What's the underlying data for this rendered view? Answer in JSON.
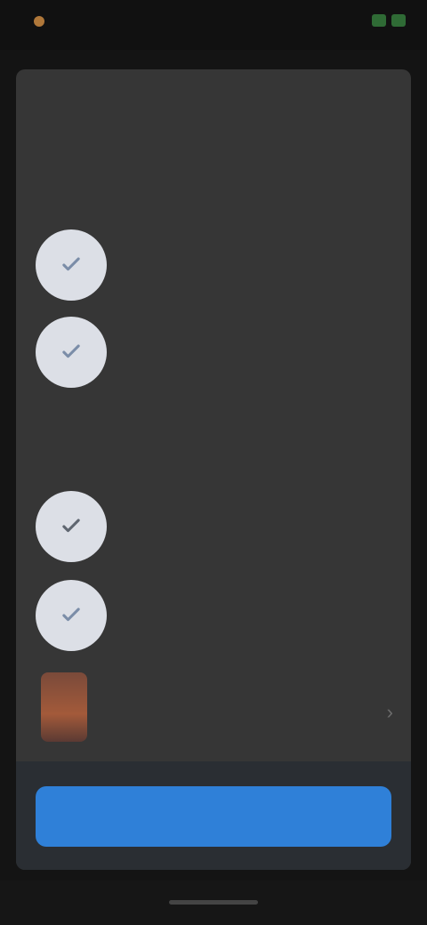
{
  "status_bar": {
    "left_text": "",
    "right_text": ""
  },
  "sheet": {
    "title": "",
    "section_one_label": "",
    "section_two_label": ""
  },
  "rows": [
    {
      "icon": "check-icon",
      "title": "",
      "subtitle": ""
    },
    {
      "icon": "check-icon",
      "title": "",
      "subtitle": ""
    },
    {
      "icon": "check-icon",
      "title": "",
      "subtitle": ""
    },
    {
      "icon": "check-icon",
      "title": "",
      "subtitle": ""
    },
    {
      "icon": "app-icon",
      "title": "",
      "subtitle": ""
    }
  ],
  "primary_action": {
    "label": ""
  },
  "colors": {
    "accent": "#2f80d8",
    "sheet": "#363636",
    "background": "#141414"
  }
}
